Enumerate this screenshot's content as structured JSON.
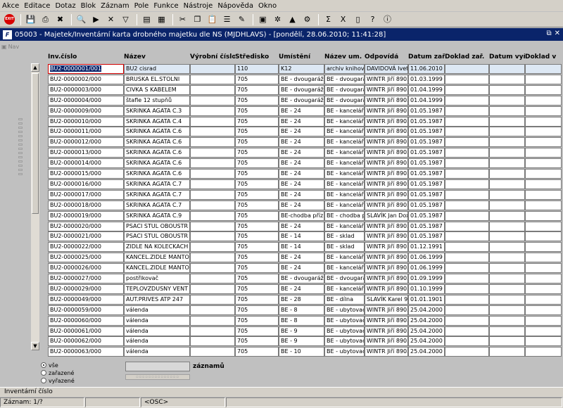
{
  "menubar": [
    "Akce",
    "Editace",
    "Dotaz",
    "Blok",
    "Záznam",
    "Pole",
    "Funkce",
    "Nástroje",
    "Nápověda",
    "Okno"
  ],
  "toolbar": {
    "exit_label": "EXIT",
    "buttons": [
      {
        "name": "save-icon",
        "glyph": "💾"
      },
      {
        "name": "print-icon",
        "glyph": "⎙"
      },
      {
        "name": "close-form-icon",
        "glyph": "✖"
      },
      {
        "name": "enter-query-icon",
        "glyph": "🔍"
      },
      {
        "name": "execute-query-icon",
        "glyph": "▶"
      },
      {
        "name": "cancel-query-icon",
        "glyph": "✕"
      },
      {
        "name": "filter-icon",
        "glyph": "▽"
      },
      {
        "name": "insert-record-icon",
        "glyph": "▤"
      },
      {
        "name": "delete-record-icon",
        "glyph": "▦"
      },
      {
        "name": "cut-icon",
        "glyph": "✂"
      },
      {
        "name": "copy-icon",
        "glyph": "❐"
      },
      {
        "name": "paste-icon",
        "glyph": "📋"
      },
      {
        "name": "list-icon",
        "glyph": "☰"
      },
      {
        "name": "edit-icon",
        "glyph": "✎"
      },
      {
        "name": "calendar-icon",
        "glyph": "▣"
      },
      {
        "name": "tools-icon",
        "glyph": "✲"
      },
      {
        "name": "warning-icon",
        "glyph": "▲"
      },
      {
        "name": "gear-icon",
        "glyph": "⚙"
      },
      {
        "name": "sigma-icon",
        "glyph": "Σ"
      },
      {
        "name": "excel-icon",
        "glyph": "X"
      },
      {
        "name": "document-icon",
        "glyph": "▯"
      },
      {
        "name": "help-icon",
        "glyph": "?"
      },
      {
        "name": "info-icon",
        "glyph": "ⓘ"
      }
    ]
  },
  "window": {
    "icon_letter": "F",
    "title": "05003 - Majetek/Inventární karta drobného majetku dle NS (MJDHLAVS) - [pondělí, 28.06.2010; 11:41:28]",
    "controls": [
      "⧉",
      "✕"
    ]
  },
  "nav": {
    "label": "Nav"
  },
  "columns": [
    "Inv.číslo",
    "Název",
    "Výrobní číslo",
    "Středisko",
    "Umístění",
    "Název um.",
    "Odpovídá",
    "Datum zař.",
    "Doklad zař.",
    "Datum vyř.",
    "Doklad v"
  ],
  "rows": [
    [
      "BU2-0000001/001",
      "BU2 cisrad",
      "",
      "110",
      "K12",
      "archiv knihovr",
      "DAVIDOVÁ Ivet",
      "11.06.2010",
      "",
      "",
      ""
    ],
    [
      "BU2-0000002/000",
      "BRUSKA EL.STOLNI",
      "",
      "705",
      "BE - dvougaráž",
      "BE - dvougará",
      "WINTR Jiří 8903",
      "01.03.1999",
      "",
      "",
      ""
    ],
    [
      "BU2-0000003/000",
      "CIVKA S KABELEM",
      "",
      "705",
      "BE - dvougaráž",
      "BE - dvougará",
      "WINTR Jiří 8903",
      "01.04.1999",
      "",
      "",
      ""
    ],
    [
      "BU2-0000004/000",
      "štafle 12 stupňů",
      "",
      "705",
      "BE - dvougaráž",
      "BE - dvougará",
      "WINTR Jiří 8903",
      "01.04.1999",
      "",
      "",
      ""
    ],
    [
      "BU2-0000009/000",
      "SKRINKA AGATA C.3",
      "",
      "705",
      "BE - 24",
      "BE - kancelář",
      "WINTR Jiří 8903",
      "01.05.1987",
      "",
      "",
      ""
    ],
    [
      "BU2-0000010/000",
      "SKRINKA AGATA C.4",
      "",
      "705",
      "BE - 24",
      "BE - kancelář",
      "WINTR Jiří 8903",
      "01.05.1987",
      "",
      "",
      ""
    ],
    [
      "BU2-0000011/000",
      "SKRINKA AGATA C.6",
      "",
      "705",
      "BE - 24",
      "BE - kancelář",
      "WINTR Jiří 8903",
      "01.05.1987",
      "",
      "",
      ""
    ],
    [
      "BU2-0000012/000",
      "SKRINKA AGATA C.6",
      "",
      "705",
      "BE - 24",
      "BE - kancelář",
      "WINTR Jiří 8903",
      "01.05.1987",
      "",
      "",
      ""
    ],
    [
      "BU2-0000013/000",
      "SKRINKA AGATA C.6",
      "",
      "705",
      "BE - 24",
      "BE - kancelář",
      "WINTR Jiří 8903",
      "01.05.1987",
      "",
      "",
      ""
    ],
    [
      "BU2-0000014/000",
      "SKRINKA AGATA C.6",
      "",
      "705",
      "BE - 24",
      "BE - kancelář",
      "WINTR Jiří 8903",
      "01.05.1987",
      "",
      "",
      ""
    ],
    [
      "BU2-0000015/000",
      "SKRINKA AGATA C.6",
      "",
      "705",
      "BE - 24",
      "BE - kancelář",
      "WINTR Jiří 8903",
      "01.05.1987",
      "",
      "",
      ""
    ],
    [
      "BU2-0000016/000",
      "SKRINKA AGATA C.7",
      "",
      "705",
      "BE - 24",
      "BE - kancelář",
      "WINTR Jiří 8903",
      "01.05.1987",
      "",
      "",
      ""
    ],
    [
      "BU2-0000017/000",
      "SKRINKA AGATA C.7",
      "",
      "705",
      "BE - 24",
      "BE - kancelář",
      "WINTR Jiří 8903",
      "01.05.1987",
      "",
      "",
      ""
    ],
    [
      "BU2-0000018/000",
      "SKRINKA AGATA C.7",
      "",
      "705",
      "BE - 24",
      "BE - kancelář",
      "WINTR Jiří 8903",
      "01.05.1987",
      "",
      "",
      ""
    ],
    [
      "BU2-0000019/000",
      "SKRINKA AGATA C.9",
      "",
      "705",
      "BE-chodba příz.",
      "BE - chodba p",
      "SLAVÍK Jan Dox",
      "01.05.1987",
      "",
      "",
      ""
    ],
    [
      "BU2-0000020/000",
      "PSACI STUL OBOUSTR",
      "",
      "705",
      "BE - 24",
      "BE - kancelář",
      "WINTR Jiří 8903",
      "01.05.1987",
      "",
      "",
      ""
    ],
    [
      "BU2-0000021/000",
      "PSACI STUL OBOUSTR",
      "",
      "705",
      "BE - 14",
      "BE - sklad",
      "WINTR Jiří 8903",
      "01.05.1987",
      "",
      "",
      ""
    ],
    [
      "BU2-0000022/000",
      "ZIDLE NA KOLECKACH",
      "",
      "705",
      "BE - 14",
      "BE - sklad",
      "WINTR Jiří 8903",
      "01.12.1991",
      "",
      "",
      ""
    ],
    [
      "BU2-0000025/000",
      "KANCEL.ZIDLE MANTO",
      "",
      "705",
      "BE - 24",
      "BE - kancelář",
      "WINTR Jiří 8903",
      "01.06.1999",
      "",
      "",
      ""
    ],
    [
      "BU2-0000026/000",
      "KANCEL.ZIDLE MANTO",
      "",
      "705",
      "BE - 24",
      "BE - kancelář",
      "WINTR Jiří 8903",
      "01.06.1999",
      "",
      "",
      ""
    ],
    [
      "BU2-0000027/000",
      "postřikovač",
      "",
      "705",
      "BE - dvougaráž",
      "BE - dvougará",
      "WINTR Jiří 8903",
      "01.09.1999",
      "",
      "",
      ""
    ],
    [
      "BU2-0000029/000",
      "TEPLOVZDUSNY VENT",
      "",
      "705",
      "BE - 24",
      "BE - kancelář",
      "WINTR Jiří 8903",
      "01.10.1999",
      "",
      "",
      ""
    ],
    [
      "BU2-0000049/000",
      "AUT.PRIVES ATP 247",
      "",
      "705",
      "BE - 28",
      "BE - dílna",
      "SLAVÍK Karel 9:",
      "01.01.1901",
      "",
      "",
      ""
    ],
    [
      "BU2-0000059/000",
      "válenda",
      "",
      "705",
      "BE - 8",
      "BE - ubytovac",
      "WINTR Jiří 8903",
      "25.04.2000",
      "",
      "",
      ""
    ],
    [
      "BU2-0000060/000",
      "válenda",
      "",
      "705",
      "BE - 8",
      "BE - ubytovac",
      "WINTR Jiří 8903",
      "25.04.2000",
      "",
      "",
      ""
    ],
    [
      "BU2-0000061/000",
      "válenda",
      "",
      "705",
      "BE - 9",
      "BE - ubytovac",
      "WINTR Jiří 8903",
      "25.04.2000",
      "",
      "",
      ""
    ],
    [
      "BU2-0000062/000",
      "válenda",
      "",
      "705",
      "BE - 9",
      "BE - ubytovac",
      "WINTR Jiří 8903",
      "25.04.2000",
      "",
      "",
      ""
    ],
    [
      "BU2-0000063/000",
      "válenda",
      "",
      "705",
      "BE - 10",
      "BE - ubytovac",
      "WINTR Jiří 8903",
      "25.04.2000",
      "",
      "",
      ""
    ]
  ],
  "filters": {
    "options": [
      {
        "label": "vše",
        "checked": true
      },
      {
        "label": "zařazené",
        "checked": false
      },
      {
        "label": "vyřazené",
        "checked": false
      }
    ]
  },
  "count": {
    "value": "",
    "label": "záznamů"
  },
  "hint": "Inventární číslo",
  "status": {
    "record": "Záznam: 1/?",
    "osc": "<OSC>"
  }
}
